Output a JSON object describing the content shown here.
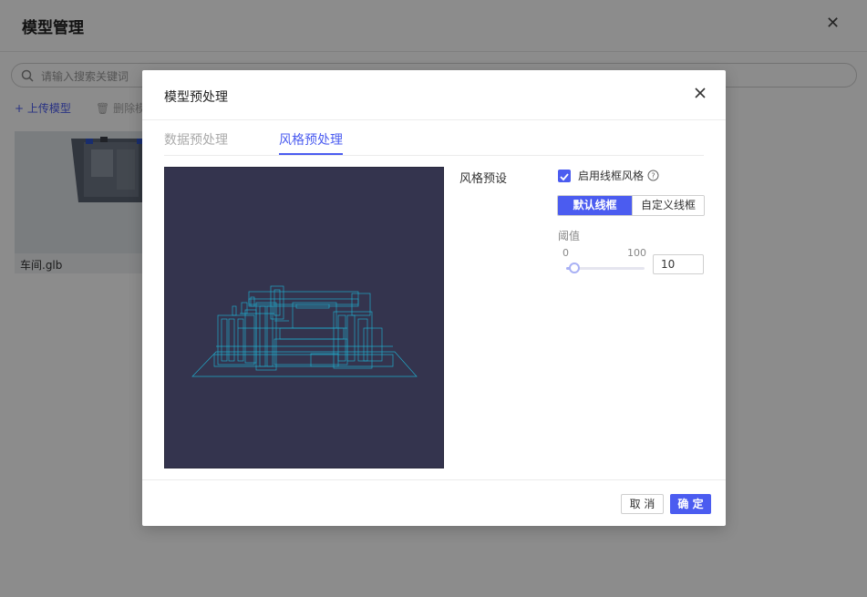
{
  "background": {
    "title": "模型管理",
    "search": {
      "placeholder": "请输入搜索关键词"
    },
    "toolbar": {
      "upload_label": "+ 上传模型",
      "delete_label": "删除模"
    },
    "cards": [
      {
        "label": "车间.glb"
      }
    ]
  },
  "dialog": {
    "title": "模型预处理",
    "tabs": [
      {
        "label": "数据预处理",
        "active": false
      },
      {
        "label": "风格预处理",
        "active": true
      }
    ],
    "style": {
      "preset_label": "风格预设",
      "wireframe_checkbox": {
        "label": "启用线框风格",
        "checked": true
      },
      "modes": [
        {
          "label": "默认线框",
          "selected": true
        },
        {
          "label": "自定义线框",
          "selected": false
        }
      ],
      "threshold": {
        "label": "阈值",
        "min": "0",
        "max": "100",
        "value": "10",
        "fraction": 0.1
      }
    },
    "footer": {
      "cancel_label": "取 消",
      "ok_label": "确 定"
    }
  },
  "colors": {
    "accent": "#4b5cf0",
    "viewport_bg": "#34344e",
    "wireframe": "#1fb6d6"
  }
}
